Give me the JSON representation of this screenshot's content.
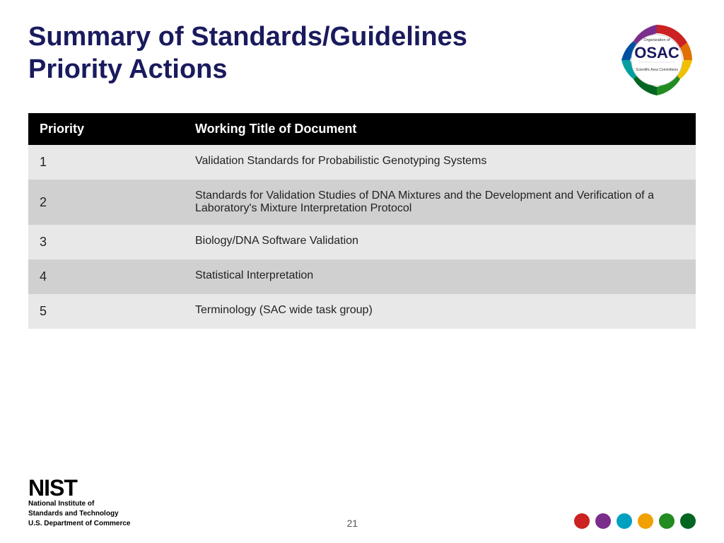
{
  "slide": {
    "title_line1": "Summary of Standards/Guidelines",
    "title_line2": "Priority Actions"
  },
  "table": {
    "headers": [
      "Priority",
      "Working Title of Document"
    ],
    "rows": [
      {
        "priority": "1",
        "title": "Validation Standards for Probabilistic Genotyping Systems"
      },
      {
        "priority": "2",
        "title": "Standards for Validation Studies of DNA Mixtures and the Development and Verification of a Laboratory's Mixture Interpretation Protocol"
      },
      {
        "priority": "3",
        "title": "Biology/DNA Software Validation"
      },
      {
        "priority": "4",
        "title": "Statistical Interpretation"
      },
      {
        "priority": "5",
        "title": "Terminology (SAC wide task group)"
      }
    ]
  },
  "footer": {
    "nist_label": "NIST",
    "nist_line1": "National Institute of",
    "nist_line2": "Standards and Technology",
    "nist_line3": "U.S. Department of Commerce",
    "page_number": "21"
  },
  "dots": [
    {
      "color": "#cc2222"
    },
    {
      "color": "#7b2d8b"
    },
    {
      "color": "#00a0c0"
    },
    {
      "color": "#f0a000"
    },
    {
      "color": "#228b22"
    },
    {
      "color": "#006622"
    }
  ]
}
